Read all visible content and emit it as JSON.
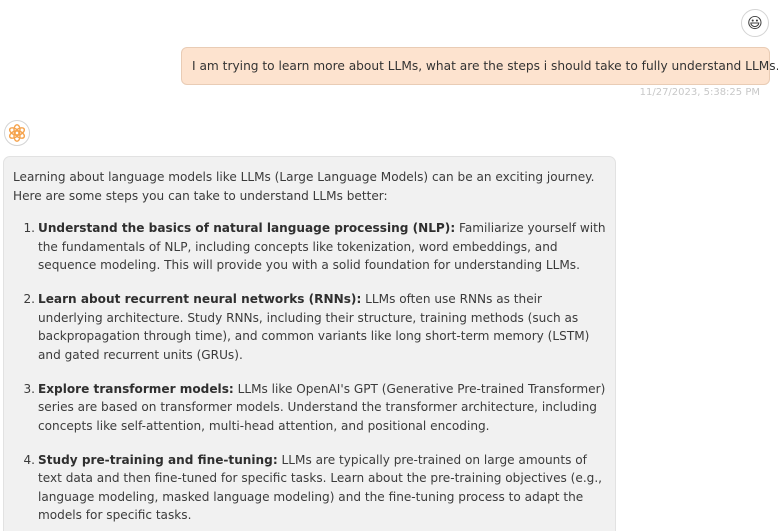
{
  "user": {
    "avatar_emoji": "😃",
    "message": "I am trying to learn more about LLMs, what are the steps i should take to fully understand LLMs.",
    "timestamp": "11/27/2023, 5:38:25 PM"
  },
  "assistant": {
    "avatar_icon": "openai-logo-icon",
    "accent_color": "#f5a34d",
    "intro": "Learning about language models like LLMs (Large Language Models) can be an exciting journey. Here are some steps you can take to understand LLMs better:",
    "steps": [
      {
        "number": "1.",
        "title": "Understand the basics of natural language processing (NLP):",
        "text": "Familiarize yourself with the fundamentals of NLP, including concepts like tokenization, word embeddings, and sequence modeling. This will provide you with a solid foundation for understanding LLMs."
      },
      {
        "number": "2.",
        "title": "Learn about recurrent neural networks (RNNs):",
        "text": "LLMs often use RNNs as their underlying architecture. Study RNNs, including their structure, training methods (such as backpropagation through time), and common variants like long short-term memory (LSTM) and gated recurrent units (GRUs)."
      },
      {
        "number": "3.",
        "title": "Explore transformer models:",
        "text": "LLMs like OpenAI's GPT (Generative Pre-trained Transformer) series are based on transformer models. Understand the transformer architecture, including concepts like self-attention, multi-head attention, and positional encoding."
      },
      {
        "number": "4.",
        "title": "Study pre-training and fine-tuning:",
        "text": "LLMs are typically pre-trained on large amounts of text data and then fine-tuned for specific tasks. Learn about the pre-training objectives (e.g., language modeling, masked language modeling) and the fine-tuning process to adapt the models for specific tasks."
      }
    ]
  }
}
